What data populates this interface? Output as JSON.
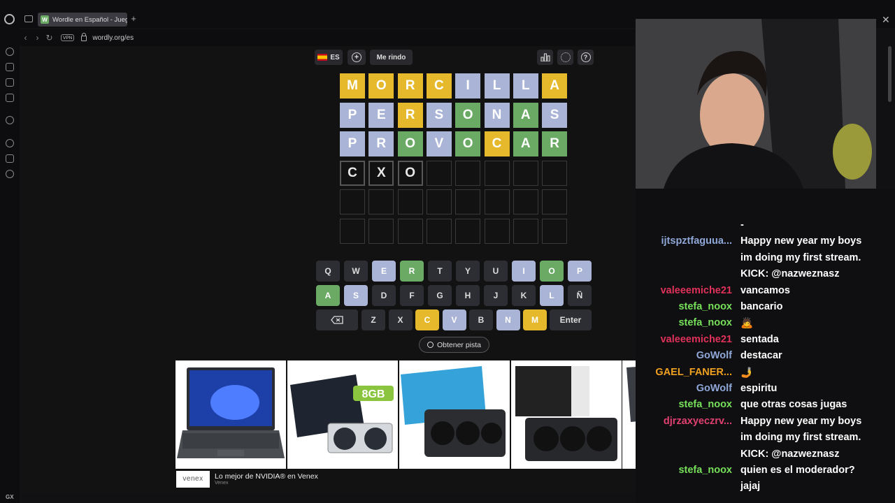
{
  "browser": {
    "tab_title": "Wordle en Español - Jueg",
    "tab_favicon": "W",
    "url": "wordly.org/es",
    "vpn_label": "VPN",
    "sidebar_bottom_label": "GX",
    "sidebar_more": "..."
  },
  "toolbar": {
    "language": "ES",
    "give_up_label": "Me rindo"
  },
  "board": {
    "rows": [
      [
        {
          "l": "M",
          "s": "y"
        },
        {
          "l": "O",
          "s": "y"
        },
        {
          "l": "R",
          "s": "y"
        },
        {
          "l": "C",
          "s": "y"
        },
        {
          "l": "I",
          "s": "b"
        },
        {
          "l": "L",
          "s": "b"
        },
        {
          "l": "L",
          "s": "b"
        },
        {
          "l": "A",
          "s": "y"
        }
      ],
      [
        {
          "l": "P",
          "s": "b"
        },
        {
          "l": "E",
          "s": "b"
        },
        {
          "l": "R",
          "s": "y"
        },
        {
          "l": "S",
          "s": "b"
        },
        {
          "l": "O",
          "s": "g"
        },
        {
          "l": "N",
          "s": "b"
        },
        {
          "l": "A",
          "s": "g"
        },
        {
          "l": "S",
          "s": "b"
        }
      ],
      [
        {
          "l": "P",
          "s": "b"
        },
        {
          "l": "R",
          "s": "b"
        },
        {
          "l": "O",
          "s": "g"
        },
        {
          "l": "V",
          "s": "b"
        },
        {
          "l": "O",
          "s": "g"
        },
        {
          "l": "C",
          "s": "y"
        },
        {
          "l": "A",
          "s": "g"
        },
        {
          "l": "R",
          "s": "g"
        }
      ],
      [
        {
          "l": "C",
          "s": "t"
        },
        {
          "l": "X",
          "s": "t"
        },
        {
          "l": "O",
          "s": "t"
        },
        {
          "l": "",
          "s": "e"
        },
        {
          "l": "",
          "s": "e"
        },
        {
          "l": "",
          "s": "e"
        },
        {
          "l": "",
          "s": "e"
        },
        {
          "l": "",
          "s": "e"
        }
      ],
      [
        {
          "l": "",
          "s": "e"
        },
        {
          "l": "",
          "s": "e"
        },
        {
          "l": "",
          "s": "e"
        },
        {
          "l": "",
          "s": "e"
        },
        {
          "l": "",
          "s": "e"
        },
        {
          "l": "",
          "s": "e"
        },
        {
          "l": "",
          "s": "e"
        },
        {
          "l": "",
          "s": "e"
        }
      ],
      [
        {
          "l": "",
          "s": "e"
        },
        {
          "l": "",
          "s": "e"
        },
        {
          "l": "",
          "s": "e"
        },
        {
          "l": "",
          "s": "e"
        },
        {
          "l": "",
          "s": "e"
        },
        {
          "l": "",
          "s": "e"
        },
        {
          "l": "",
          "s": "e"
        },
        {
          "l": "",
          "s": "e"
        }
      ]
    ]
  },
  "keyboard": {
    "row1": [
      {
        "k": "Q",
        "s": "d"
      },
      {
        "k": "W",
        "s": "d"
      },
      {
        "k": "E",
        "s": "b"
      },
      {
        "k": "R",
        "s": "g"
      },
      {
        "k": "T",
        "s": "d"
      },
      {
        "k": "Y",
        "s": "d"
      },
      {
        "k": "U",
        "s": "d"
      },
      {
        "k": "I",
        "s": "b"
      },
      {
        "k": "O",
        "s": "g"
      },
      {
        "k": "P",
        "s": "b"
      }
    ],
    "row2": [
      {
        "k": "A",
        "s": "g"
      },
      {
        "k": "S",
        "s": "b"
      },
      {
        "k": "D",
        "s": "d"
      },
      {
        "k": "F",
        "s": "d"
      },
      {
        "k": "G",
        "s": "d"
      },
      {
        "k": "H",
        "s": "d"
      },
      {
        "k": "J",
        "s": "d"
      },
      {
        "k": "K",
        "s": "d"
      },
      {
        "k": "L",
        "s": "b"
      },
      {
        "k": "Ñ",
        "s": "d"
      }
    ],
    "row3": [
      {
        "k": "Z",
        "s": "d"
      },
      {
        "k": "X",
        "s": "d"
      },
      {
        "k": "C",
        "s": "y"
      },
      {
        "k": "V",
        "s": "b"
      },
      {
        "k": "B",
        "s": "d"
      },
      {
        "k": "N",
        "s": "b"
      },
      {
        "k": "M",
        "s": "y"
      }
    ],
    "backspace_icon": "backspace-icon",
    "enter_label": "Enter"
  },
  "hint_button": "Obtener pista",
  "ad": {
    "title": "Lo mejor de NVIDIA® en Venex",
    "advertiser": "Venex",
    "logo_text": "venex",
    "card_badge": "8GB"
  },
  "chat": [
    {
      "user": "",
      "msg": "-",
      "color": "#b0b0b0"
    },
    {
      "user": "ijtspztfaguua...",
      "msg": "Happy new year my boys",
      "color": "#8fa8d8"
    },
    {
      "user": "",
      "msg": "im doing my first stream.",
      "color": "#8fa8d8"
    },
    {
      "user": "",
      "msg": "KICK: @nazweznasz",
      "color": "#8fa8d8"
    },
    {
      "user": "valeeemiche21",
      "msg": "vancamos",
      "color": "#e0315a"
    },
    {
      "user": "stefa_noox",
      "msg": "bancario",
      "color": "#76e05a"
    },
    {
      "user": "stefa_noox",
      "msg": "🙇",
      "color": "#76e05a"
    },
    {
      "user": "valeeemiche21",
      "msg": "sentada",
      "color": "#e0315a"
    },
    {
      "user": "GoWolf",
      "msg": "destacar",
      "color": "#8fa8d8"
    },
    {
      "user": "GAEL_FANER...",
      "msg": "🤳",
      "color": "#f0a020"
    },
    {
      "user": "GoWolf",
      "msg": "espiritu",
      "color": "#8fa8d8"
    },
    {
      "user": "stefa_noox",
      "msg": "que otras cosas jugas",
      "color": "#76e05a"
    },
    {
      "user": "djrzaxyeczrv...",
      "msg": "Happy new year my boys",
      "color": "#e04070"
    },
    {
      "user": "",
      "msg": "im doing my first stream.",
      "color": "#e04070"
    },
    {
      "user": "",
      "msg": "KICK: @nazweznasz",
      "color": "#e04070"
    },
    {
      "user": "stefa_noox",
      "msg": "quien es el moderador?",
      "color": "#76e05a"
    },
    {
      "user": "",
      "msg": "jajaj",
      "color": "#76e05a"
    }
  ]
}
